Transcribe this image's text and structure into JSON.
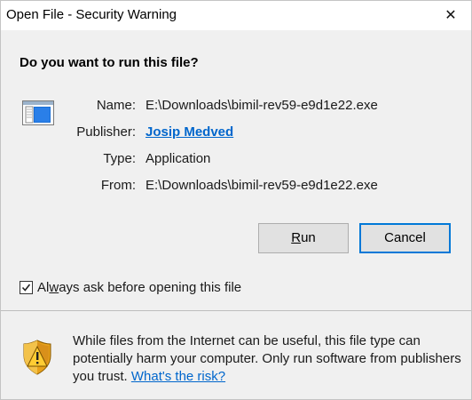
{
  "window": {
    "title": "Open File - Security Warning",
    "close_glyph": "✕"
  },
  "heading": "Do you want to run this file?",
  "file_info": {
    "name_label": "Name:",
    "name_value": "E:\\Downloads\\bimil-rev59-e9d1e22.exe",
    "publisher_label": "Publisher:",
    "publisher_value": "Josip Medved",
    "type_label": "Type:",
    "type_value": "Application",
    "from_label": "From:",
    "from_value": "E:\\Downloads\\bimil-rev59-e9d1e22.exe"
  },
  "buttons": {
    "run_accel": "R",
    "run_rest": "un",
    "cancel": "Cancel"
  },
  "always_ask": {
    "checked": true,
    "label_pre": "Al",
    "label_accel": "w",
    "label_post": "ays ask before opening this file"
  },
  "warning": {
    "text": "While files from the Internet can be useful, this file type can potentially harm your computer. Only run software from publishers you trust. ",
    "link": "What's the risk?"
  },
  "icons": {
    "file": "application-window-icon",
    "shield": "security-shield-warning-icon",
    "checkbox": "checkmark-icon",
    "close": "close-icon"
  },
  "colors": {
    "link": "#0066cc",
    "focus_border": "#0078d7",
    "button_bg": "#e1e1e1",
    "dialog_bg": "#f0f0f0"
  }
}
